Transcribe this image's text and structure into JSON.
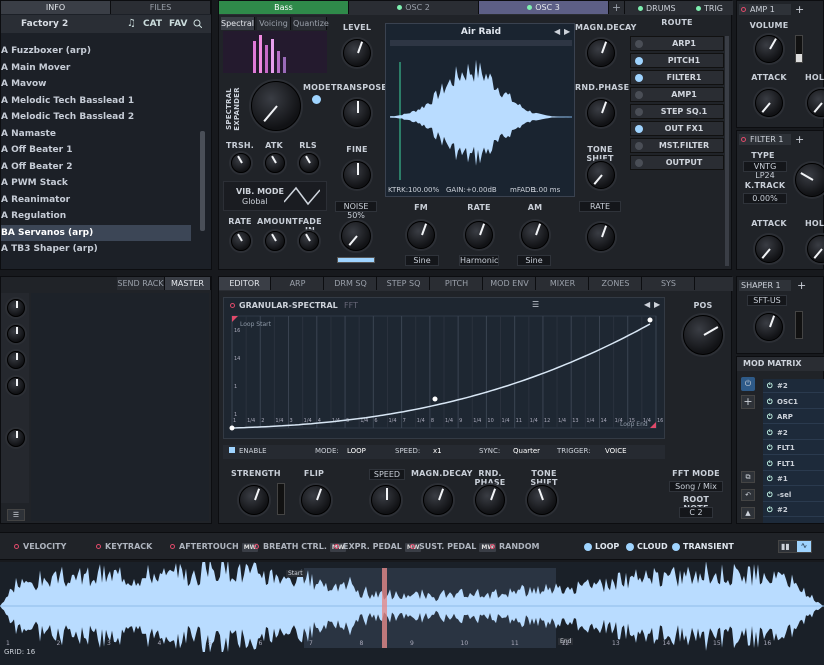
{
  "browser": {
    "tabs": [
      "INFO",
      "FILES"
    ],
    "folder": "Factory 2",
    "icons": {
      "note": "♫",
      "cat": "CAT",
      "fav": "FAV"
    },
    "items": [
      "A Fuzzboxer (arp)",
      "A Main Mover",
      "A Mavow",
      "A Melodic Tech Basslead 1",
      "A Melodic Tech Basslead 2",
      "A Namaste",
      "A Off Beater 1",
      "A Off Beater 2",
      "A PWM Stack",
      "A Reanimator",
      "A Regulation",
      "BA Servanos (arp)",
      "A TB3 Shaper (arp)"
    ],
    "selected_index": 11
  },
  "osc_tabs": [
    "Bass",
    "OSC 2",
    "OSC 3",
    "+"
  ],
  "osc_subtabs": [
    "Spectral",
    "Voicing",
    "Quantize"
  ],
  "osc": {
    "spectral_label": "SPECTRAL EXPANDER",
    "mode": "MODE",
    "trsh": "TRSH.",
    "atk": "ATK",
    "rls": "RLS",
    "vib_mode": "VIB. MODE",
    "vib_value": "Global",
    "rate": "RATE",
    "amount": "AMOUNT",
    "fade_in": "FADE IN",
    "level": "LEVEL",
    "transpose": "TRANSPOSE",
    "fine": "FINE",
    "noise": "NOISE 50%",
    "wave_name": "Air Raid",
    "ktrk": "KTRK:",
    "ktrk_val": "100.00%",
    "gain": "GAIN:",
    "gain_val": "+0.00dB",
    "mfade": "mFADE:",
    "mfade_val": "1.00 ms",
    "fm": "FM",
    "fm_val": "Sine",
    "rate2": "RATE",
    "rate2_val": "Harmonic",
    "am": "AM",
    "am_val": "Sine",
    "magn_decay": "MAGN.DECAY",
    "rnd_phase": "RND.PHASE",
    "tone_shift": "TONE SHIFT",
    "rate_btn": "RATE"
  },
  "route": {
    "title": "ROUTE",
    "items": [
      {
        "label": "ARP1",
        "on": false
      },
      {
        "label": "PITCH1",
        "on": true
      },
      {
        "label": "FILTER1",
        "on": true
      },
      {
        "label": "AMP1",
        "on": false
      },
      {
        "label": "STEP SQ.1",
        "on": false
      },
      {
        "label": "OUT FX1",
        "on": true
      },
      {
        "label": "MST.FILTER",
        "on": false
      },
      {
        "label": "OUTPUT",
        "on": false
      }
    ]
  },
  "top_tabs_right": [
    "DRUMS",
    "TRIG"
  ],
  "amp": {
    "title": "AMP 1",
    "volume": "VOLUME",
    "attack": "ATTACK",
    "hold": "HOLD"
  },
  "filter": {
    "title": "FILTER 1",
    "type": "TYPE",
    "type_val": "VNTG LP24",
    "ktrack": "K.TRACK",
    "ktrack_val": "0.00%",
    "attack": "ATTACK",
    "hold": "HOLD"
  },
  "shaper": {
    "title": "SHAPER 1",
    "val": "SFT-US"
  },
  "modmatrix": {
    "title": "MOD MATRIX",
    "rows": [
      "#2",
      "OSC1",
      "ARP",
      "#2",
      "FLT1",
      "FLT1",
      "#1",
      "-sel",
      "#2"
    ]
  },
  "fxrack": {
    "tabs": [
      "SEND RACK",
      "MASTER FX"
    ]
  },
  "editor_tabs": [
    "EDITOR",
    "ARP",
    "DRM SQ",
    "STEP SQ",
    "PITCH",
    "MOD ENV",
    "MIXER",
    "ZONES",
    "SYS"
  ],
  "editor": {
    "title": "GRANULAR-SPECTRAL",
    "fft": "FFT",
    "loop_start": "Loop Start",
    "loop_end": "Loop End",
    "y_ticks": [
      "16",
      "14",
      "1",
      "1"
    ],
    "x_ticks": [
      "1",
      "1/4",
      "2",
      "1/4",
      "3",
      "1/4",
      "4",
      "1/4",
      "5",
      "1/4",
      "6",
      "1/4",
      "7",
      "1/4",
      "8",
      "1/4",
      "9",
      "1/4",
      "10",
      "1/4",
      "11",
      "1/4",
      "12",
      "1/4",
      "13",
      "1/4",
      "14",
      "1/4",
      "15",
      "1/4",
      "16"
    ],
    "enable": "ENABLE",
    "mode": "MODE:",
    "mode_val": "LOOP",
    "speed": "SPEED:",
    "speed_val": "x1",
    "sync": "SYNC:",
    "sync_val": "Quarter",
    "trigger": "TRIGGER:",
    "trigger_val": "VOICE",
    "pos": "POS",
    "strength": "STRENGTH",
    "flip": "FLIP",
    "speed_btn": "SPEED",
    "magn_decay": "MAGN.DECAY",
    "rnd_phase": "RND. PHASE",
    "tone_shift": "TONE SHIFT",
    "fft_mode": "FFT MODE",
    "fft_mode_val": "Song / Mix",
    "root_note": "ROOT NOTE",
    "root_val": "C 2"
  },
  "mod_sources": [
    "VELOCITY",
    "KEYTRACK",
    "AFTERTOUCH",
    "BREATH CTRL.",
    "EXPR. PEDAL",
    "SUST. PEDAL",
    "RANDOM"
  ],
  "mw_badge": "MW",
  "toggles": [
    "LOOP",
    "CLOUD",
    "TRANSIENT"
  ],
  "bottom_wave": {
    "start": "Start",
    "end": "End",
    "grid": "GRID: 16",
    "ticks": [
      "1",
      "2",
      "3",
      "4",
      "5",
      "6",
      "7",
      "8",
      "9",
      "10",
      "11",
      "12",
      "13",
      "14",
      "15",
      "16"
    ]
  },
  "colors": {
    "accent": "#9fd4ff",
    "wave": "#b9dcff",
    "playhead": "#e38a8a",
    "green": "#7ef0b0",
    "red": "#e04a6a"
  }
}
